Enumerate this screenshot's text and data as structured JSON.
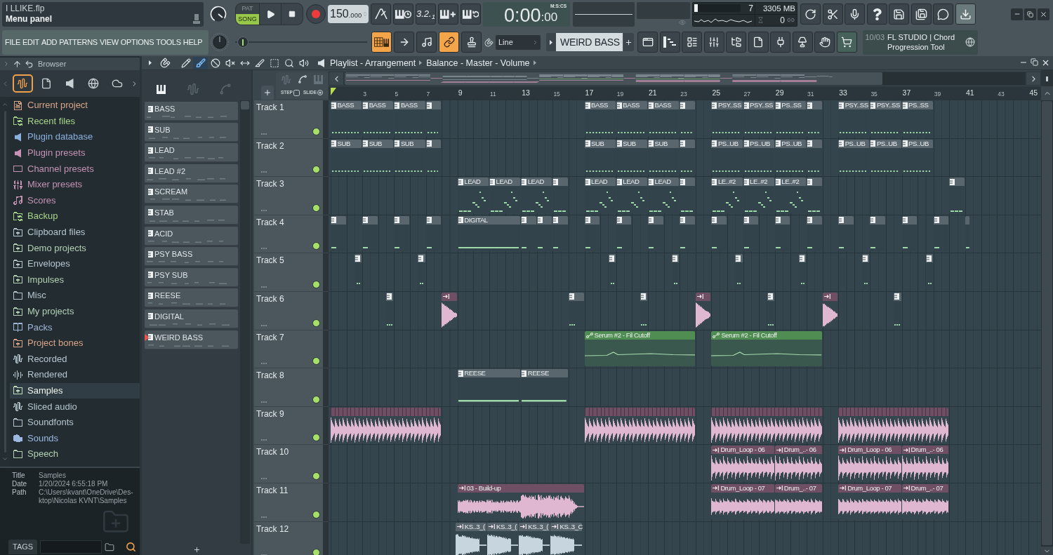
{
  "title_panel": {
    "file": "I LLIKE.flp",
    "hint": "Menu panel"
  },
  "transport": {
    "modes": [
      {
        "label": "PAT",
        "selected": false
      },
      {
        "label": "SONG",
        "selected": true
      }
    ],
    "tempo": "150",
    "tempo_fraction": ".000"
  },
  "countdown": "3.2.$_{1}$",
  "time_display": {
    "value": "0:00",
    "fraction": ":00",
    "format": "M:S:CS"
  },
  "cpu_panel": {
    "cpu": {
      "level": 0.08
    },
    "polyphony": "7",
    "memory": "3305 MB",
    "readout": "0"
  },
  "app_buttons": [
    {
      "on": false
    },
    {
      "on": false
    },
    {
      "on": false
    },
    {
      "on": false
    },
    {
      "on": false
    },
    {
      "on": false
    },
    {
      "on": false
    },
    {
      "on": true
    }
  ],
  "menu": [
    "FILE",
    "EDIT",
    "ADD",
    "PATTERNS",
    "VIEW",
    "OPTIONS",
    "TOOLS",
    "HELP"
  ],
  "pitch_slider": {
    "level": 0.02
  },
  "view_buttons": [
    {
      "on": true
    },
    {
      "on": false
    },
    {
      "on": false
    },
    {
      "on": true
    },
    {
      "on": false
    }
  ],
  "snap": {
    "value": "Line"
  },
  "pattern_selector": {
    "name": "WEIRD BASS"
  },
  "news": {
    "counter": "10/03",
    "text": "FL STUDIO | Chord Progression Tool"
  },
  "browser": {
    "title": "Browser",
    "tabs": [
      {
        "selected": true
      },
      {
        "selected": false
      },
      {
        "selected": false
      },
      {
        "selected": false
      },
      {
        "selected": false
      }
    ],
    "items": [
      {
        "label": "Current project",
        "color": "#d9a588",
        "selected": false
      },
      {
        "label": "Recent files",
        "color": "#a8d48a",
        "selected": false
      },
      {
        "label": "Plugin database",
        "color": "#8cb0de",
        "selected": false
      },
      {
        "label": "Plugin presets",
        "color": "#c792b5",
        "selected": false
      },
      {
        "label": "Channel presets",
        "color": "#c592b3",
        "selected": false
      },
      {
        "label": "Mixer presets",
        "color": "#c592b3",
        "selected": false
      },
      {
        "label": "Scores",
        "color": "#c592b3",
        "selected": false
      },
      {
        "label": "Backup",
        "color": "#a8d48a",
        "selected": false
      },
      {
        "label": "Clipboard files",
        "color": "#b5c6cf",
        "selected": false
      },
      {
        "label": "Demo projects",
        "color": "#b4d0b4",
        "selected": false
      },
      {
        "label": "Envelopes",
        "color": "#b5c6cf",
        "selected": false
      },
      {
        "label": "Impulses",
        "color": "#b4d0b4",
        "selected": false
      },
      {
        "label": "Misc",
        "color": "#b5c6cf",
        "selected": false
      },
      {
        "label": "My projects",
        "color": "#b4d0b4",
        "selected": false
      },
      {
        "label": "Packs",
        "color": "#9fb6d6",
        "selected": false
      },
      {
        "label": "Project bones",
        "color": "#d9a588",
        "selected": false
      },
      {
        "label": "Recorded",
        "color": "#b5c6cf",
        "selected": false
      },
      {
        "label": "Rendered",
        "color": "#b5c6cf",
        "selected": false
      },
      {
        "label": "Samples",
        "color": "#c2dcc0",
        "selected": true
      },
      {
        "label": "Sliced audio",
        "color": "#b5c6cf",
        "selected": false
      },
      {
        "label": "Soundfonts",
        "color": "#b5c6cf",
        "selected": false
      },
      {
        "label": "Sounds",
        "color": "#9ab8e0",
        "selected": false
      },
      {
        "label": "Speech",
        "color": "#b4d0b4",
        "selected": false
      }
    ],
    "info": [
      {
        "label": "Title",
        "value": [
          "Samples"
        ]
      },
      {
        "label": "Date",
        "value": [
          "1/20/2024 6:55:18 PM"
        ]
      },
      {
        "label": "Path",
        "value": [
          "C:\\Users\\kvant\\OneDrive\\Des-",
          "ktop\\Nicolas KVNT\\Samples"
        ]
      }
    ],
    "tags_button": "TAGS"
  },
  "playlist": {
    "tools": [
      {
        "selected": false
      },
      {
        "selected": true
      },
      {
        "selected": false
      },
      {
        "selected": false
      },
      {
        "selected": false
      },
      {
        "selected": false
      },
      {
        "selected": false
      },
      {
        "selected": false
      },
      {
        "selected": false
      }
    ],
    "title": "Playlist - Arrangement",
    "target": "Balance - Master - Volume",
    "picker_tabs": [
      {
        "selected": true
      },
      {
        "selected": false
      },
      {
        "selected": false
      }
    ],
    "patterns": [
      {
        "name": "BASS",
        "selected": false
      },
      {
        "name": "SUB",
        "selected": false
      },
      {
        "name": "LEAD",
        "selected": false
      },
      {
        "name": "LEAD #2",
        "selected": false
      },
      {
        "name": "SCREAM",
        "selected": false
      },
      {
        "name": "STAB",
        "selected": false
      },
      {
        "name": "ACID",
        "selected": false
      },
      {
        "name": "PSY BASS",
        "selected": false
      },
      {
        "name": "PSY SUB",
        "selected": false
      },
      {
        "name": "REESE",
        "selected": false
      },
      {
        "name": "DIGITAL",
        "selected": false
      },
      {
        "name": "WEIRD BASS",
        "selected": true
      }
    ],
    "track_options": [
      {
        "label": "STEP",
        "kind": "checkbox",
        "on": false
      },
      {
        "label": "SLIDE",
        "kind": "radio",
        "on": true
      }
    ],
    "ruler": [
      "3",
      "5",
      "7",
      "9",
      "11",
      "13",
      "15",
      "17",
      "19",
      "21",
      "23",
      "25",
      "27",
      "29",
      "31",
      "33",
      "35",
      "37",
      "39",
      "41",
      "43",
      "45"
    ],
    "tracks": [
      {
        "name": "Track 1",
        "active": true,
        "clips": [
          {
            "kind": "pattern",
            "label": "BASS"
          },
          {
            "kind": "pattern",
            "label": "BASS"
          },
          {
            "kind": "pattern",
            "label": "BASS"
          },
          {
            "kind": "pattern"
          },
          {
            "kind": "pattern",
            "label": "BASS"
          },
          {
            "kind": "pattern",
            "label": "BASS"
          },
          {
            "kind": "pattern",
            "label": "BASS"
          },
          {
            "kind": "pattern"
          },
          {
            "kind": "pattern",
            "label": "PSY..SS"
          },
          {
            "kind": "pattern",
            "label": "PSY..SS"
          },
          {
            "kind": "pattern",
            "label": "PS..SS"
          },
          {
            "kind": "pattern"
          },
          {
            "kind": "pattern",
            "label": "PSY..SS"
          },
          {
            "kind": "pattern",
            "label": "PSY..SS"
          },
          {
            "kind": "pattern",
            "label": "PS..SS"
          }
        ]
      },
      {
        "name": "Track 2",
        "active": true,
        "clips": [
          {
            "kind": "pattern",
            "label": "SUB"
          },
          {
            "kind": "pattern",
            "label": "SUB"
          },
          {
            "kind": "pattern",
            "label": "SUB"
          },
          {
            "kind": "pattern"
          },
          {
            "kind": "pattern",
            "label": "SUB"
          },
          {
            "kind": "pattern",
            "label": "SUB"
          },
          {
            "kind": "pattern",
            "label": "SUB"
          },
          {
            "kind": "pattern"
          },
          {
            "kind": "pattern",
            "label": "PS..UB"
          },
          {
            "kind": "pattern",
            "label": "PS..UB"
          },
          {
            "kind": "pattern",
            "label": "PS..UB"
          },
          {
            "kind": "pattern"
          },
          {
            "kind": "pattern",
            "label": "PS..UB"
          },
          {
            "kind": "pattern",
            "label": "PS..UB"
          },
          {
            "kind": "pattern",
            "label": "PS..UB"
          }
        ]
      },
      {
        "name": "Track 3",
        "active": true,
        "clips": [
          {
            "kind": "pattern",
            "label": "LEAD"
          },
          {
            "kind": "pattern",
            "label": "LEAD"
          },
          {
            "kind": "pattern",
            "label": "LEAD"
          },
          {
            "kind": "pattern"
          },
          {
            "kind": "pattern",
            "label": "LEAD"
          },
          {
            "kind": "pattern",
            "label": "LEAD"
          },
          {
            "kind": "pattern",
            "label": "LEAD"
          },
          {
            "kind": "pattern"
          },
          {
            "kind": "pattern",
            "label": "LE..#2"
          },
          {
            "kind": "pattern",
            "label": "LE..#2"
          },
          {
            "kind": "pattern",
            "label": "LE..#2"
          },
          {
            "kind": "pattern"
          },
          {
            "kind": "pattern"
          }
        ]
      },
      {
        "name": "Track 4",
        "active": true,
        "clips": [
          {
            "kind": "pattern"
          },
          {
            "kind": "pattern"
          },
          {
            "kind": "pattern"
          },
          {
            "kind": "pattern"
          },
          {
            "kind": "pattern",
            "label": "DIGITAL"
          },
          {
            "kind": "pattern"
          },
          {
            "kind": "pattern"
          },
          {
            "kind": "pattern"
          },
          {
            "kind": "pattern"
          },
          {
            "kind": "pattern"
          },
          {
            "kind": "pattern"
          },
          {
            "kind": "pattern"
          },
          {
            "kind": "pattern"
          },
          {
            "kind": "pattern"
          },
          {
            "kind": "pattern"
          },
          {
            "kind": "pattern"
          },
          {
            "kind": "pattern"
          },
          {
            "kind": "pattern"
          },
          {
            "kind": "pattern"
          },
          {
            "kind": "pattern"
          },
          {
            "kind": "pattern"
          }
        ]
      },
      {
        "name": "Track 5",
        "active": true,
        "clips": [
          {
            "kind": "pattern"
          },
          {
            "kind": "pattern"
          },
          {
            "kind": "pattern"
          },
          {
            "kind": "pattern"
          },
          {
            "kind": "pattern"
          },
          {
            "kind": "pattern"
          },
          {
            "kind": "pattern"
          },
          {
            "kind": "pattern"
          }
        ]
      },
      {
        "name": "Track 6",
        "active": true,
        "clips": [
          {
            "kind": "pattern"
          },
          {
            "kind": "audio",
            "color": "#6e4f63"
          },
          {
            "kind": "pattern"
          },
          {
            "kind": "pattern"
          },
          {
            "kind": "audio",
            "color": "#6e4f63"
          },
          {
            "kind": "pattern"
          },
          {
            "kind": "audio",
            "color": "#6e4f63"
          },
          {
            "kind": "pattern"
          }
        ]
      },
      {
        "name": "Track 7",
        "active": true,
        "clips": [
          {
            "kind": "automation",
            "label": "Serum #2 - Fil Cutoff"
          },
          {
            "kind": "automation",
            "label": "Serum #2 - Fil Cutoff"
          }
        ]
      },
      {
        "name": "Track 8",
        "active": true,
        "clips": [
          {
            "kind": "pattern",
            "label": "REESE"
          },
          {
            "kind": "pattern",
            "label": "REESE"
          }
        ]
      },
      {
        "name": "Track 9",
        "active": true,
        "clips": [
          {
            "kind": "sliced",
            "color": "#6e4f63"
          },
          {
            "kind": "sliced",
            "color": "#6e4f63"
          },
          {
            "kind": "sliced",
            "color": "#6e4f63"
          },
          {
            "kind": "sliced",
            "color": "#6e4f63"
          }
        ]
      },
      {
        "name": "Track 10",
        "active": true,
        "clips": [
          {
            "kind": "audio",
            "label": "Drum_Loop - 06",
            "color": "#6e4f63"
          },
          {
            "kind": "audio",
            "label": "Drum_..- 06",
            "color": "#6e4f63"
          },
          {
            "kind": "audio",
            "label": "Drum_Loop - 06",
            "color": "#6e4f63"
          },
          {
            "kind": "audio",
            "label": "Drum_..- 06",
            "color": "#6e4f63"
          }
        ]
      },
      {
        "name": "Track 11",
        "active": true,
        "clips": [
          {
            "kind": "audio",
            "label": "03 - Build-up",
            "color": "#6e4f63"
          },
          {
            "kind": "audio",
            "label": "Drum_Loop - 07",
            "color": "#6e4f63"
          },
          {
            "kind": "audio",
            "label": "Drum_..- 07",
            "color": "#6e4f63"
          },
          {
            "kind": "audio",
            "label": "Drum_Loop - 07",
            "color": "#6e4f63"
          },
          {
            "kind": "audio",
            "label": "Drum_..- 07",
            "color": "#6e4f63"
          }
        ]
      },
      {
        "name": "Track 12",
        "active": true,
        "clips": [
          {
            "kind": "audio",
            "label": "KS..3_(",
            "color": "#58646b"
          },
          {
            "kind": "audio",
            "label": "KS..3_(",
            "color": "#58646b"
          },
          {
            "kind": "audio",
            "label": "KS..3_(",
            "color": "#58646b"
          },
          {
            "kind": "audio",
            "label": "KS..3_C",
            "color": "#58646b"
          }
        ]
      }
    ]
  }
}
